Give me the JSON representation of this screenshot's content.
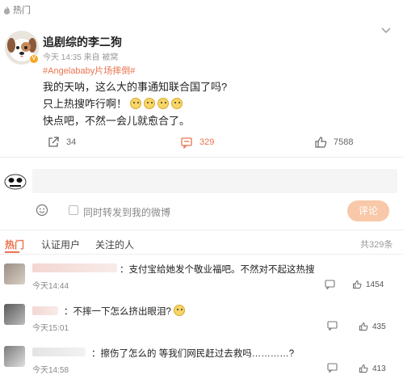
{
  "hot_label": "热门",
  "post": {
    "author": "追剧综的李二狗",
    "meta": "今天 14:35  来自 被窝",
    "hashtag": "#Angelababy片场摔倒#",
    "lines": [
      "我的天呐，这么大的事通知联合国了吗?",
      "只上热搜咋行啊！",
      "快点吧，不然一会儿就愈合了。"
    ],
    "repost_count": "34",
    "comment_count": "329",
    "like_count": "7588"
  },
  "composer": {
    "placeholder": "",
    "repost_label": "同时转发到我的微博",
    "submit_label": "评论"
  },
  "tabs": [
    "热门",
    "认证用户",
    "关注的人"
  ],
  "total_comments": "共329条",
  "comments": [
    {
      "text": "：支付宝给她发个敬业福吧。不然对不起这热搜",
      "time": "今天14:44",
      "likes": "1454"
    },
    {
      "text": "：不摔一下怎么挤出眼泪?",
      "time": "今天15:01",
      "likes": "435"
    },
    {
      "text": "：擦伤了怎么的 等我们网民赶过去救吗…………?",
      "time": "今天14:58",
      "likes": "413"
    }
  ],
  "colors": {
    "accent": "#eb7350",
    "submit_bg": "#f8c8a8"
  }
}
